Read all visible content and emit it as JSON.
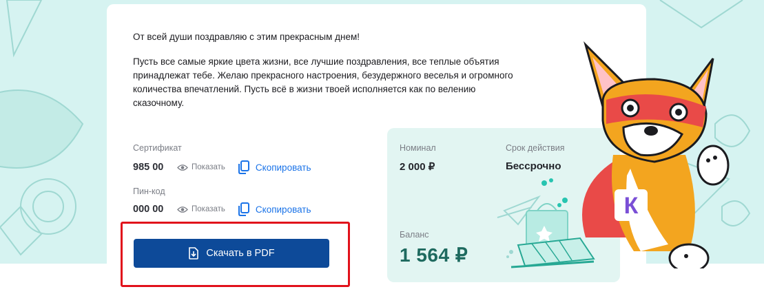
{
  "message": {
    "greeting": "От всей души поздравляю с этим прекрасным днем!",
    "body": "Пусть все самые яркие цвета жизни, все лучшие поздравления, все теплые объятия принадлежат тебе. Желаю прекрасного настроения, безудержного веселья и огромного количества впечатлений. Пусть всё в жизни твоей исполняется как по велению сказочному."
  },
  "certificate": {
    "label": "Сертификат",
    "code": "985 00",
    "show_label": "Показать",
    "copy_label": "Скопировать"
  },
  "pin": {
    "label": "Пин-код",
    "code": "000 00",
    "show_label": "Показать",
    "copy_label": "Скопировать"
  },
  "download": {
    "label": "Скачать в PDF"
  },
  "info": {
    "nominal_label": "Номинал",
    "nominal_value": "2 000 ₽",
    "validity_label": "Срок действия",
    "validity_value": "Бессрочно",
    "balance_label": "Баланс",
    "balance_value": "1 564 ₽"
  },
  "mascot": {
    "badge_letter": "К"
  },
  "colors": {
    "background": "#d6f3f1",
    "primary_button": "#0d4a99",
    "link": "#1a73e8",
    "highlight": "#e1111b",
    "balance": "#1e6a5f",
    "info_card": "#e2f5f2"
  },
  "icons": [
    "eye-icon",
    "copy-icon",
    "download-file-icon"
  ]
}
